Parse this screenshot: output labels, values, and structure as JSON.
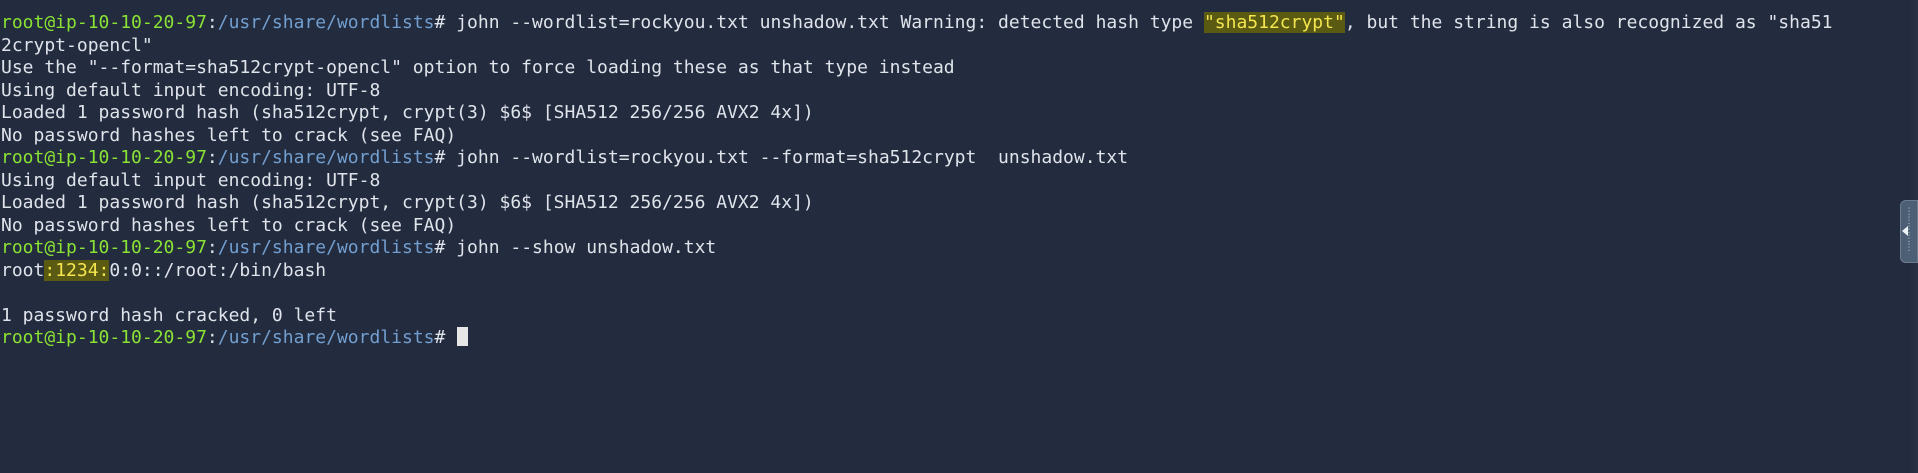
{
  "prompt": {
    "user": "root@ip-10-10-20-97",
    "sep": ":",
    "path": "/usr/share/wordlists",
    "symbol": "# "
  },
  "lines": {
    "l1_cmd": "john --wordlist=rockyou.txt unshadow.txt Warning: detected hash type ",
    "l1_hl": "\"sha512crypt\"",
    "l1_rest": ", but the string is also recognized as \"sha51",
    "l2": "2crypt-opencl\"",
    "l3": "Use the \"--format=sha512crypt-opencl\" option to force loading these as that type instead",
    "l4": "Using default input encoding: UTF-8",
    "l5": "Loaded 1 password hash (sha512crypt, crypt(3) $6$ [SHA512 256/256 AVX2 4x])",
    "l6": "No password hashes left to crack (see FAQ)",
    "l7_cmd": "john --wordlist=rockyou.txt --format=sha512crypt  unshadow.txt",
    "l8": "Using default input encoding: UTF-8",
    "l9": "Loaded 1 password hash (sha512crypt, crypt(3) $6$ [SHA512 256/256 AVX2 4x])",
    "l10": "No password hashes left to crack (see FAQ)",
    "l11_cmd": "john --show unshadow.txt",
    "l12_pre": "root",
    "l12_hl": ":1234:",
    "l12_post": "0:0::/root:/bin/bash",
    "l13": "",
    "l14": "1 password hash cracked, 0 left"
  },
  "colors": {
    "background": "#232b3f",
    "prompt_user": "#8ae234",
    "prompt_path": "#729fcf",
    "highlight_bg": "#5a5a12",
    "highlight_fg": "#f4e64f"
  },
  "icons": {
    "scroll_handle": "scroll-handle-icon"
  }
}
